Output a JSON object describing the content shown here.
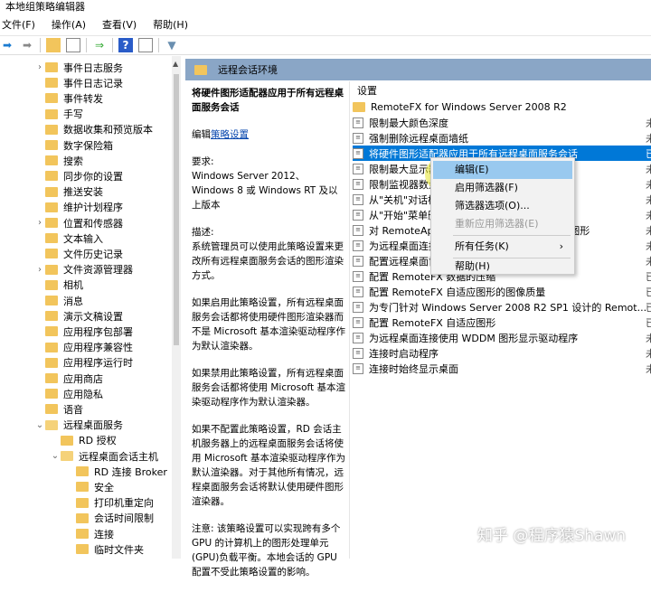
{
  "window": {
    "title": "本地组策略编辑器"
  },
  "menu": [
    "文件(F)",
    "操作(A)",
    "查看(V)",
    "帮助(H)"
  ],
  "tree": [
    {
      "label": "事件日志服务",
      "level": 1,
      "chev": "›"
    },
    {
      "label": "事件日志记录",
      "level": 1,
      "chev": ""
    },
    {
      "label": "事件转发",
      "level": 1,
      "chev": ""
    },
    {
      "label": "手写",
      "level": 1,
      "chev": ""
    },
    {
      "label": "数据收集和预览版本",
      "level": 1,
      "chev": ""
    },
    {
      "label": "数字保险箱",
      "level": 1,
      "chev": ""
    },
    {
      "label": "搜索",
      "level": 1,
      "chev": ""
    },
    {
      "label": "同步你的设置",
      "level": 1,
      "chev": ""
    },
    {
      "label": "推送安装",
      "level": 1,
      "chev": ""
    },
    {
      "label": "维护计划程序",
      "level": 1,
      "chev": ""
    },
    {
      "label": "位置和传感器",
      "level": 1,
      "chev": "›"
    },
    {
      "label": "文本输入",
      "level": 1,
      "chev": ""
    },
    {
      "label": "文件历史记录",
      "level": 1,
      "chev": ""
    },
    {
      "label": "文件资源管理器",
      "level": 1,
      "chev": "›"
    },
    {
      "label": "相机",
      "level": 1,
      "chev": ""
    },
    {
      "label": "消息",
      "level": 1,
      "chev": ""
    },
    {
      "label": "演示文稿设置",
      "level": 1,
      "chev": ""
    },
    {
      "label": "应用程序包部署",
      "level": 1,
      "chev": ""
    },
    {
      "label": "应用程序兼容性",
      "level": 1,
      "chev": ""
    },
    {
      "label": "应用程序运行时",
      "level": 1,
      "chev": ""
    },
    {
      "label": "应用商店",
      "level": 1,
      "chev": ""
    },
    {
      "label": "应用隐私",
      "level": 1,
      "chev": ""
    },
    {
      "label": "语音",
      "level": 1,
      "chev": ""
    },
    {
      "label": "远程桌面服务",
      "level": 1,
      "chev": "⌄"
    },
    {
      "label": "RD 授权",
      "level": 2,
      "chev": ""
    },
    {
      "label": "远程桌面会话主机",
      "level": 2,
      "chev": "⌄"
    },
    {
      "label": "RD 连接 Broker",
      "level": 3,
      "chev": ""
    },
    {
      "label": "安全",
      "level": 3,
      "chev": ""
    },
    {
      "label": "打印机重定向",
      "level": 3,
      "chev": ""
    },
    {
      "label": "会话时间限制",
      "level": 3,
      "chev": ""
    },
    {
      "label": "连接",
      "level": 3,
      "chev": ""
    },
    {
      "label": "临时文件夹",
      "level": 3,
      "chev": ""
    }
  ],
  "header": {
    "title": "远程会话环境"
  },
  "description": {
    "title": "将硬件图形适配器应用于所有远程桌面服务会话",
    "edit_prefix": "编辑",
    "edit_link": "策略设置",
    "requirements_label": "要求:",
    "requirements": "Windows Server 2012、Windows 8 或 Windows RT 及以上版本",
    "desc_label": "描述:",
    "desc": "系统管理员可以使用此策略设置来更改所有远程桌面服务会话的图形渲染方式。",
    "enabled": "如果启用此策略设置，所有远程桌面服务会话都将使用硬件图形渲染器而不是 Microsoft 基本渲染驱动程序作为默认渲染器。",
    "disabled": "如果禁用此策略设置，所有远程桌面服务会话都将使用 Microsoft 基本渲染驱动程序作为默认渲染器。",
    "not_configured": "如果不配置此策略设置，RD 会话主机服务器上的远程桌面服务会话将使用 Microsoft 基本渲染驱动程序作为默认渲染器。对于其他所有情况，远程桌面服务会话将默认使用硬件图形渲染器。",
    "note": "注意: 该策略设置可以实现跨有多个 GPU 的计算机上的图形处理单元(GPU)负载平衡。本地会话的 GPU 配置不受此策略设置的影响。"
  },
  "list": {
    "column_setting": "设置",
    "rows": [
      {
        "label": "RemoteFX for Windows Server 2008 R2",
        "type": "folder",
        "state": ""
      },
      {
        "label": "限制最大颜色深度",
        "type": "policy",
        "state": "未"
      },
      {
        "label": "强制删除远程桌面墙纸",
        "type": "policy",
        "state": "未"
      },
      {
        "label": "将硬件图形适配器应用于所有远程桌面服务会话",
        "type": "policy",
        "state": "已",
        "selected": true
      },
      {
        "label": "限制最大显示器分辨率",
        "type": "policy",
        "state": "未"
      },
      {
        "label": "限制监视器数量",
        "type": "policy",
        "state": "未"
      },
      {
        "label": "从\"关机\"对话框删除\"断开连接\"选项",
        "type": "policy",
        "state": "未"
      },
      {
        "label": "从\"开始\"菜单删除\"Windows 安全\"项",
        "type": "policy",
        "state": "未"
      },
      {
        "label": "对 RemoteApp 和桌面使用高级 RemoteFX 图形",
        "type": "policy",
        "state": "未"
      },
      {
        "label": "为远程桌面连接设置压缩算法的优先级",
        "type": "policy",
        "state": "未"
      },
      {
        "label": "配置远程桌面协议的图像质量",
        "type": "policy",
        "state": "未"
      },
      {
        "label": "配置 RemoteFX 数据的压缩",
        "type": "policy",
        "state": "已"
      },
      {
        "label": "配置 RemoteFX 自适应图形的图像质量",
        "type": "policy",
        "state": "已"
      },
      {
        "label": "为专门针对 Windows Server 2008 R2 SP1 设计的 Remot...",
        "type": "policy",
        "state": "已"
      },
      {
        "label": "配置 RemoteFX 自适应图形",
        "type": "policy",
        "state": "已"
      },
      {
        "label": "为远程桌面连接使用 WDDM 图形显示驱动程序",
        "type": "policy",
        "state": "未"
      },
      {
        "label": "连接时启动程序",
        "type": "policy",
        "state": "未"
      },
      {
        "label": "连接时始终显示桌面",
        "type": "policy",
        "state": "未"
      }
    ]
  },
  "context_menu": {
    "edit": "编辑(E)",
    "apply_filter": "启用筛选器(F)",
    "filter_options": "筛选器选项(O)...",
    "reapply_filter": "重新应用筛选器(E)",
    "all_tasks": "所有任务(K)",
    "all_tasks_arrow": "›",
    "help": "帮助(H)"
  },
  "watermark": "知乎 @程序猿Shawn"
}
